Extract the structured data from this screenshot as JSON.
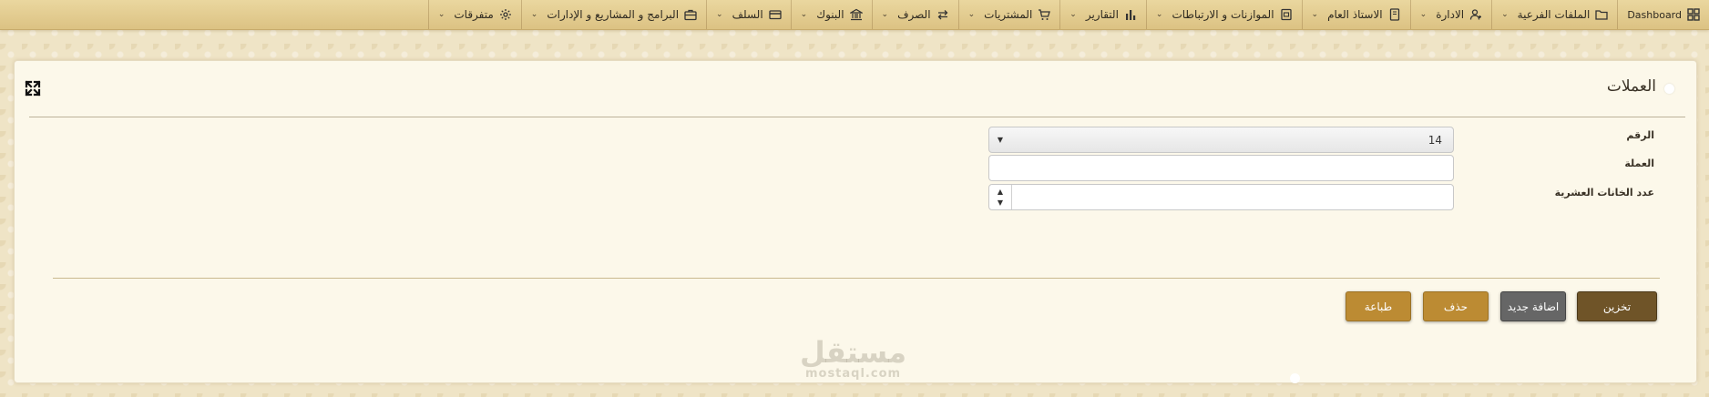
{
  "nav": {
    "items": [
      {
        "label": "Dashboard",
        "icon": "grid-icon",
        "dropdown": false
      },
      {
        "label": "الملفات الفرعية",
        "icon": "folder-icon",
        "dropdown": true
      },
      {
        "label": "الادارة",
        "icon": "users-icon",
        "dropdown": true
      },
      {
        "label": "الاستاذ العام",
        "icon": "book-icon",
        "dropdown": true
      },
      {
        "label": "الموازنات و الارتباطات",
        "icon": "ledger-icon",
        "dropdown": true
      },
      {
        "label": "التقارير",
        "icon": "bar-chart-icon",
        "dropdown": true
      },
      {
        "label": "المشتريات",
        "icon": "cart-icon",
        "dropdown": true
      },
      {
        "label": "الصرف",
        "icon": "exchange-icon",
        "dropdown": true
      },
      {
        "label": "البنوك",
        "icon": "bank-icon",
        "dropdown": true
      },
      {
        "label": "السلف",
        "icon": "card-icon",
        "dropdown": true
      },
      {
        "label": "البرامج و المشاريع و الإدارات",
        "icon": "briefcase-icon",
        "dropdown": true
      },
      {
        "label": "متفرقات",
        "icon": "gear-icon",
        "dropdown": true
      }
    ]
  },
  "page": {
    "title": "العملات"
  },
  "form": {
    "number_label": "الرقم",
    "number_value": "14",
    "currency_label": "العملة",
    "currency_value": "",
    "decimals_label": "عدد الخانات العشرية",
    "decimals_value": ""
  },
  "buttons": {
    "save": "تخزين",
    "add_new": "اضافة جديد",
    "delete": "حذف",
    "print": "طباعة"
  },
  "watermark": {
    "arabic": "مستقل",
    "latin": "mostaql.com"
  },
  "colors": {
    "navbar": "#e3cc8f",
    "card_bg": "#fcf8ea",
    "save_btn": "#6f5428",
    "add_btn": "#666666",
    "gold_btn": "#bc8b33"
  }
}
